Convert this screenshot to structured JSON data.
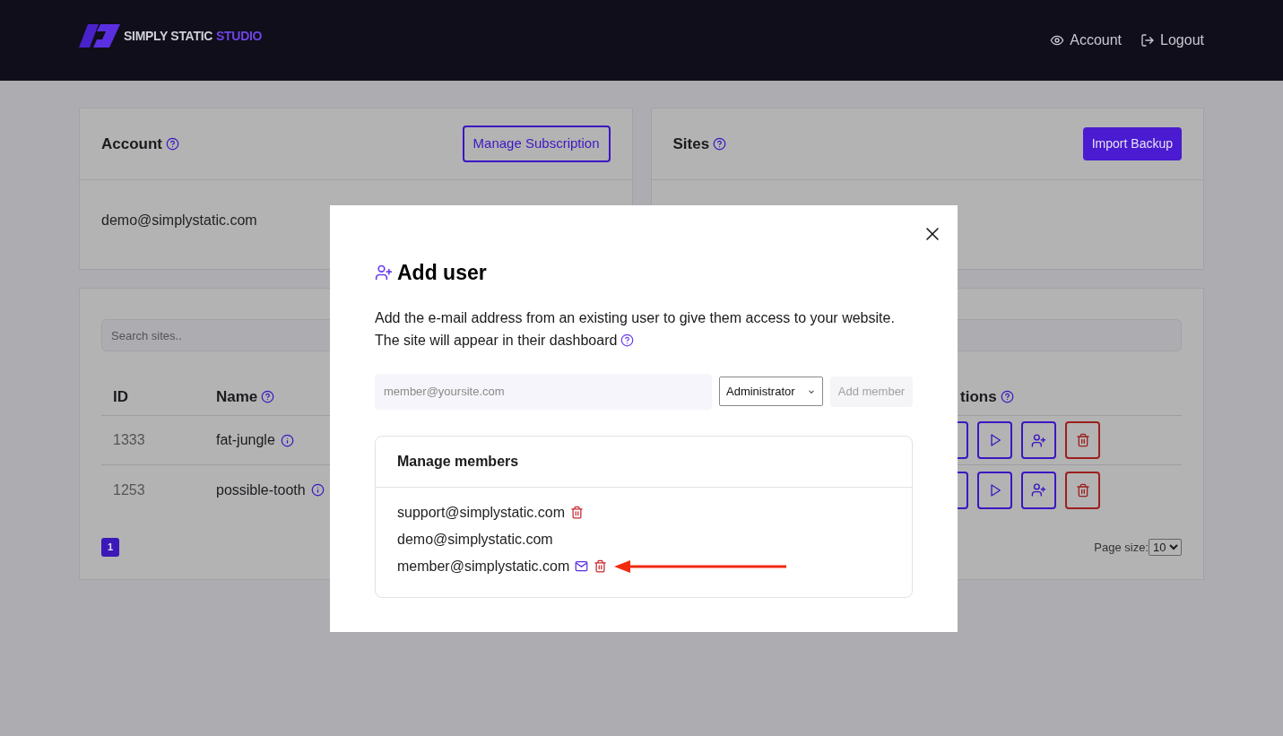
{
  "header": {
    "logo": {
      "main": "SIMPLY STATIC",
      "accent": "STUDIO"
    },
    "nav": [
      {
        "kind": "eye",
        "label": "Account"
      },
      {
        "kind": "logout",
        "label": "Logout"
      }
    ]
  },
  "account_panel": {
    "title": "Account",
    "button": "Manage Subscription",
    "email": "demo@simplystatic.com"
  },
  "sites_panel": {
    "title": "Sites",
    "button": "Import Backup"
  },
  "sites_table": {
    "search_placeholder": "Search sites..",
    "columns": [
      {
        "label": "ID",
        "help": false
      },
      {
        "label": "Name",
        "help": true
      },
      {
        "label": "tions",
        "help": true
      }
    ],
    "rows": [
      {
        "id": "1333",
        "name": "fat-jungle",
        "actions": [
          {
            "kind": "covered"
          },
          {
            "kind": "play"
          },
          {
            "kind": "add_user"
          },
          {
            "kind": "delete"
          }
        ]
      },
      {
        "id": "1253",
        "name": "possible-tooth",
        "actions": [
          {
            "kind": "covered"
          },
          {
            "kind": "play"
          },
          {
            "kind": "add_user"
          },
          {
            "kind": "delete"
          }
        ]
      }
    ],
    "pages": [
      {
        "label": "1",
        "selected": true
      }
    ],
    "page_size": {
      "label": "Page size:",
      "value": "10"
    }
  },
  "modal": {
    "title": "Add user",
    "description": [
      "Add the e-mail address from an existing user to give them access to your website.",
      "The site will appear in their dashboard"
    ],
    "email_placeholder": "member@yoursite.com",
    "role": "Administrator",
    "add_button": {
      "label": "Add member",
      "disabled": true
    },
    "members": {
      "title": "Manage members",
      "items": [
        {
          "email": "support@simplystatic.com",
          "resend": false,
          "delete": true
        },
        {
          "email": "demo@simplystatic.com",
          "resend": false,
          "delete": false
        },
        {
          "email": "member@simplystatic.com",
          "resend": true,
          "delete": true,
          "highlighted": true
        }
      ]
    }
  }
}
